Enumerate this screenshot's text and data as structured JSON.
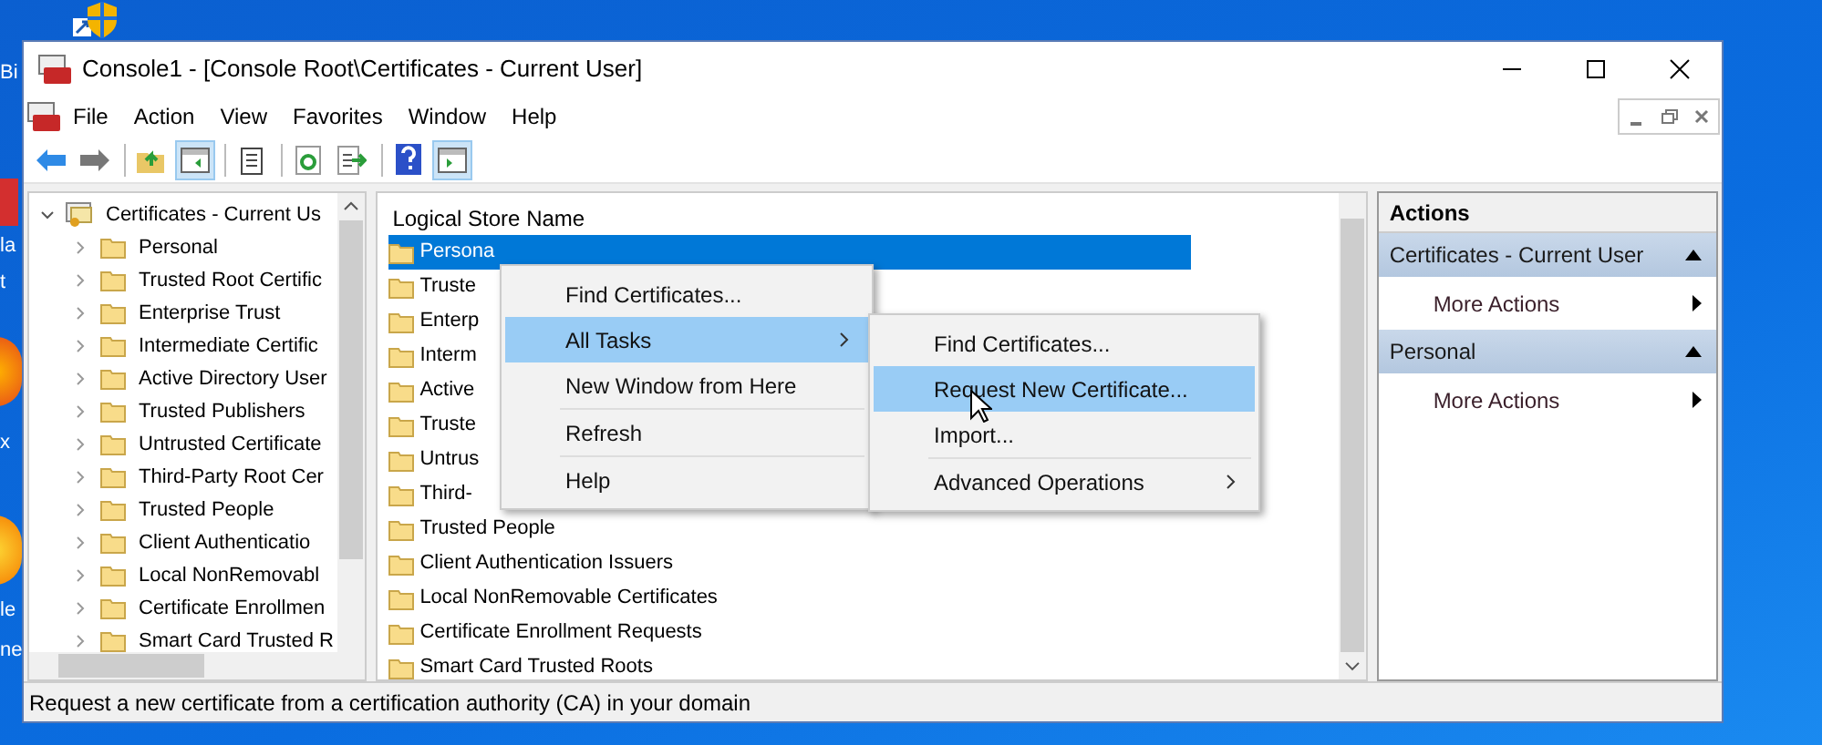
{
  "desktop": {
    "label_fragments": [
      {
        "label": "Bi"
      },
      {
        "label": "la"
      },
      {
        "label": "t"
      },
      {
        "label": "x"
      },
      {
        "label": "le"
      },
      {
        "label": "ne"
      }
    ]
  },
  "window": {
    "title": "Console1 - [Console Root\\Certificates - Current User]"
  },
  "menu_bar": [
    "File",
    "Action",
    "View",
    "Favorites",
    "Window",
    "Help"
  ],
  "toolbar": [
    {
      "pressed": false
    },
    {
      "pressed": false
    },
    {
      "pressed": false
    },
    {
      "pressed": true
    },
    {
      "pressed": false
    },
    {
      "pressed": false
    },
    {
      "pressed": false
    },
    {
      "pressed": false
    },
    {
      "pressed": true
    }
  ],
  "tree": {
    "root": {
      "label": "Certificates - Current Us",
      "expanded": true,
      "children": [
        {
          "label": "Personal",
          "expanded": false
        },
        {
          "label": "Trusted Root Certific",
          "expanded": false
        },
        {
          "label": "Enterprise Trust",
          "expanded": false
        },
        {
          "label": "Intermediate Certific",
          "expanded": false
        },
        {
          "label": "Active Directory User",
          "expanded": false
        },
        {
          "label": "Trusted Publishers",
          "expanded": false
        },
        {
          "label": "Untrusted Certificate",
          "expanded": false
        },
        {
          "label": "Third-Party Root Cer",
          "expanded": false
        },
        {
          "label": "Trusted People",
          "expanded": false
        },
        {
          "label": "Client Authenticatio",
          "expanded": false
        },
        {
          "label": "Local NonRemovabl",
          "expanded": false
        },
        {
          "label": "Certificate Enrollmen",
          "expanded": false
        },
        {
          "label": "Smart Card Trusted R",
          "expanded": false
        }
      ]
    }
  },
  "list": {
    "column": "Logical Store Name",
    "rows": [
      {
        "name": "Persona",
        "selected": true
      },
      {
        "name": "Truste",
        "selected": false
      },
      {
        "name": "Enterp",
        "selected": false
      },
      {
        "name": "Interm",
        "selected": false
      },
      {
        "name": "Active",
        "selected": false
      },
      {
        "name": "Truste",
        "selected": false
      },
      {
        "name": "Untrus",
        "selected": false
      },
      {
        "name": "Third-",
        "selected": false
      },
      {
        "name": "Trusted People",
        "selected": false
      },
      {
        "name": "Client Authentication Issuers",
        "selected": false
      },
      {
        "name": "Local NonRemovable Certificates",
        "selected": false
      },
      {
        "name": "Certificate Enrollment Requests",
        "selected": false
      },
      {
        "name": "Smart Card Trusted Roots",
        "selected": false
      }
    ]
  },
  "context_menu": [
    {
      "label": "Find Certificates...",
      "selected": false,
      "submenu": false
    },
    {
      "label": "All Tasks",
      "selected": true,
      "submenu": true
    },
    {
      "label": "New Window from Here",
      "selected": false,
      "submenu": false
    },
    {
      "label": "Refresh",
      "selected": false,
      "submenu": false
    },
    {
      "label": "Help",
      "selected": false,
      "submenu": false
    }
  ],
  "submenu": [
    {
      "label": "Find Certificates...",
      "selected": false,
      "submenu": false
    },
    {
      "label": "Request New Certificate...",
      "selected": true,
      "submenu": false
    },
    {
      "label": "Import...",
      "selected": false,
      "submenu": false
    },
    {
      "label": "Advanced Operations",
      "selected": false,
      "submenu": true
    }
  ],
  "actions": {
    "title": "Actions",
    "sections": [
      {
        "title": "Certificates - Current User",
        "expanded": true,
        "items": [
          "More Actions"
        ]
      },
      {
        "title": "Personal",
        "expanded": true,
        "items": [
          "More Actions"
        ]
      }
    ]
  },
  "status_bar": "Request a new certificate from a certification authority (CA) in your domain"
}
